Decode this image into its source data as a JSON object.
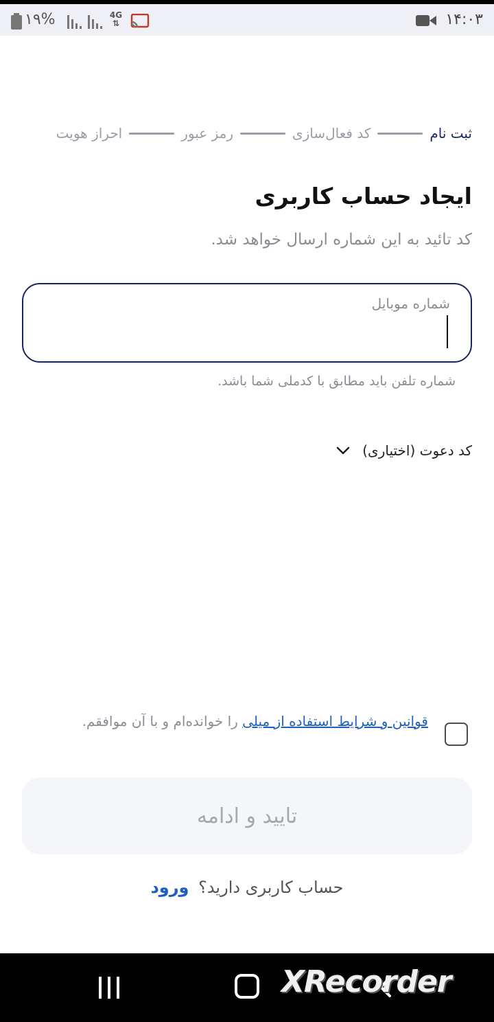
{
  "status_bar": {
    "time": "۱۴:۰۳",
    "battery": "۱۹%",
    "network": "4G"
  },
  "stepper": {
    "steps": [
      "ثبت نام",
      "کد فعال‌سازی",
      "رمز عبور",
      "احراز هویت"
    ],
    "active_index": 0
  },
  "header": {
    "title": "ایجاد حساب کاربری",
    "subtitle": "کد تائید به این شماره ارسال خواهد شد."
  },
  "phone_field": {
    "label": "شماره موبایل",
    "value": "",
    "hint": "شماره تلفن باید مطابق با کدملی شما باشد."
  },
  "invite_code": {
    "label": "کد دعوت (اختیاری)"
  },
  "terms": {
    "link_text": "قوانین و شرایط استفاده از میلی",
    "suffix": " را خوانده‌ام و با آن موافقم.",
    "checked": false
  },
  "cta": {
    "label": "تایید و ادامه"
  },
  "login": {
    "prompt": "حساب کاربری دارید؟",
    "link": "ورود"
  },
  "watermark": "XRecorder",
  "colors": {
    "accent_navy": "#1b2360",
    "link_blue": "#1f5fbf",
    "muted_gray": "#8b8d96"
  }
}
